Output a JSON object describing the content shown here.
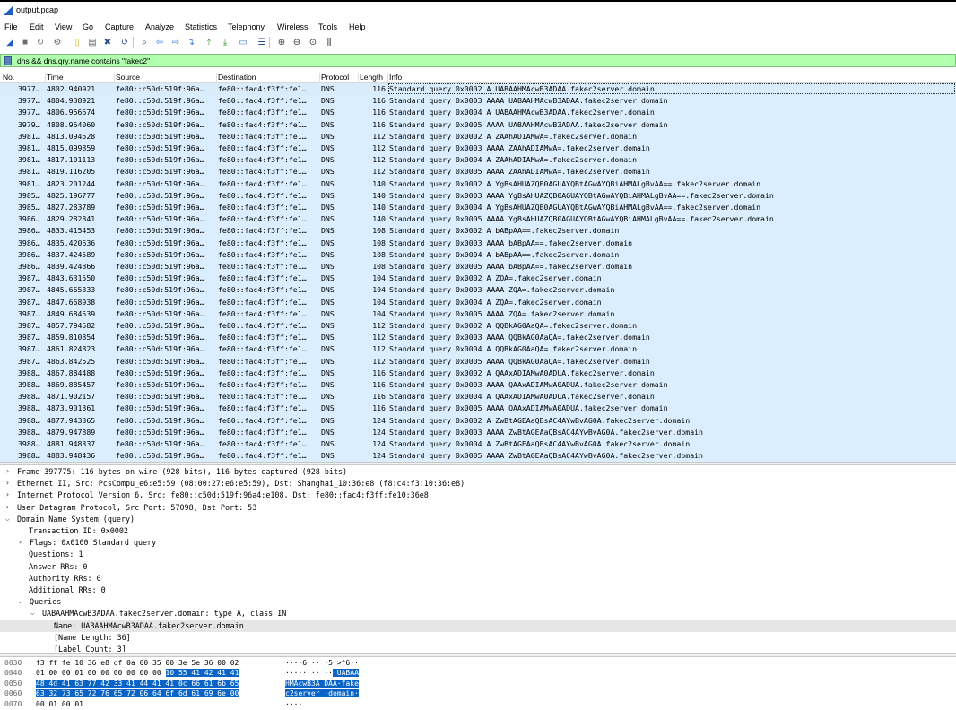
{
  "window": {
    "title": "output.pcap"
  },
  "menu": [
    "File",
    "Edit",
    "View",
    "Go",
    "Capture",
    "Analyze",
    "Statistics",
    "Telephony",
    "Wireless",
    "Tools",
    "Help"
  ],
  "toolbar_icons": [
    "shark-start-icon",
    "stop-icon",
    "restart-icon",
    "options-icon",
    "open-icon",
    "save-icon",
    "close-file-icon",
    "reload-icon",
    "find-icon",
    "back-icon",
    "forward-icon",
    "goto-icon",
    "first-icon",
    "last-icon",
    "autoscroll-icon",
    "colorize-icon",
    "zoom-in-icon",
    "zoom-out-icon",
    "zoom-reset-icon",
    "resize-columns-icon"
  ],
  "filter": {
    "text": "dns && dns.qry.name contains \"fakec2\"",
    "bg": "#afffaf"
  },
  "columns": [
    "No.",
    "Time",
    "Source",
    "Destination",
    "Protocol",
    "Length",
    "Info"
  ],
  "packets": [
    {
      "no": "3977…",
      "time": "4802.940921",
      "src": "fe80::c50d:519f:96a…",
      "dst": "fe80::fac4:f3ff:fe1…",
      "proto": "DNS",
      "len": "116",
      "info": "Standard query 0x0002 A UABAAHMAcwB3ADAA.fakec2server.domain"
    },
    {
      "no": "3977…",
      "time": "4804.938921",
      "src": "fe80::c50d:519f:96a…",
      "dst": "fe80::fac4:f3ff:fe1…",
      "proto": "DNS",
      "len": "116",
      "info": "Standard query 0x0003 AAAA UABAAHMAcwB3ADAA.fakec2server.domain"
    },
    {
      "no": "3977…",
      "time": "4806.956674",
      "src": "fe80::c50d:519f:96a…",
      "dst": "fe80::fac4:f3ff:fe1…",
      "proto": "DNS",
      "len": "116",
      "info": "Standard query 0x0004 A UABAAHMAcwB3ADAA.fakec2server.domain"
    },
    {
      "no": "3979…",
      "time": "4808.964060",
      "src": "fe80::c50d:519f:96a…",
      "dst": "fe80::fac4:f3ff:fe1…",
      "proto": "DNS",
      "len": "116",
      "info": "Standard query 0x0005 AAAA UABAAHMAcwB3ADAA.fakec2server.domain"
    },
    {
      "no": "3981…",
      "time": "4813.094528",
      "src": "fe80::c50d:519f:96a…",
      "dst": "fe80::fac4:f3ff:fe1…",
      "proto": "DNS",
      "len": "112",
      "info": "Standard query 0x0002 A ZAAhADIAMwA=.fakec2server.domain"
    },
    {
      "no": "3981…",
      "time": "4815.099859",
      "src": "fe80::c50d:519f:96a…",
      "dst": "fe80::fac4:f3ff:fe1…",
      "proto": "DNS",
      "len": "112",
      "info": "Standard query 0x0003 AAAA ZAAhADIAMwA=.fakec2server.domain"
    },
    {
      "no": "3981…",
      "time": "4817.101113",
      "src": "fe80::c50d:519f:96a…",
      "dst": "fe80::fac4:f3ff:fe1…",
      "proto": "DNS",
      "len": "112",
      "info": "Standard query 0x0004 A ZAAhADIAMwA=.fakec2server.domain"
    },
    {
      "no": "3981…",
      "time": "4819.116205",
      "src": "fe80::c50d:519f:96a…",
      "dst": "fe80::fac4:f3ff:fe1…",
      "proto": "DNS",
      "len": "112",
      "info": "Standard query 0x0005 AAAA ZAAhADIAMwA=.fakec2server.domain"
    },
    {
      "no": "3981…",
      "time": "4823.201244",
      "src": "fe80::c50d:519f:96a…",
      "dst": "fe80::fac4:f3ff:fe1…",
      "proto": "DNS",
      "len": "140",
      "info": "Standard query 0x0002 A YgBsAHUAZQB0AGUAYQBtAGwAYQBiAHMALgBvAA==.fakec2server.domain"
    },
    {
      "no": "3985…",
      "time": "4825.196777",
      "src": "fe80::c50d:519f:96a…",
      "dst": "fe80::fac4:f3ff:fe1…",
      "proto": "DNS",
      "len": "140",
      "info": "Standard query 0x0003 AAAA YgBsAHUAZQB0AGUAYQBtAGwAYQBiAHMALgBvAA==.fakec2server.domain"
    },
    {
      "no": "3985…",
      "time": "4827.283789",
      "src": "fe80::c50d:519f:96a…",
      "dst": "fe80::fac4:f3ff:fe1…",
      "proto": "DNS",
      "len": "140",
      "info": "Standard query 0x0004 A YgBsAHUAZQB0AGUAYQBtAGwAYQBiAHMALgBvAA==.fakec2server.domain"
    },
    {
      "no": "3986…",
      "time": "4829.282841",
      "src": "fe80::c50d:519f:96a…",
      "dst": "fe80::fac4:f3ff:fe1…",
      "proto": "DNS",
      "len": "140",
      "info": "Standard query 0x0005 AAAA YgBsAHUAZQB0AGUAYQBtAGwAYQBiAHMALgBvAA==.fakec2server.domain"
    },
    {
      "no": "3986…",
      "time": "4833.415453",
      "src": "fe80::c50d:519f:96a…",
      "dst": "fe80::fac4:f3ff:fe1…",
      "proto": "DNS",
      "len": "108",
      "info": "Standard query 0x0002 A bABpAA==.fakec2server.domain"
    },
    {
      "no": "3986…",
      "time": "4835.420636",
      "src": "fe80::c50d:519f:96a…",
      "dst": "fe80::fac4:f3ff:fe1…",
      "proto": "DNS",
      "len": "108",
      "info": "Standard query 0x0003 AAAA bABpAA==.fakec2server.domain"
    },
    {
      "no": "3986…",
      "time": "4837.424589",
      "src": "fe80::c50d:519f:96a…",
      "dst": "fe80::fac4:f3ff:fe1…",
      "proto": "DNS",
      "len": "108",
      "info": "Standard query 0x0004 A bABpAA==.fakec2server.domain"
    },
    {
      "no": "3986…",
      "time": "4839.424866",
      "src": "fe80::c50d:519f:96a…",
      "dst": "fe80::fac4:f3ff:fe1…",
      "proto": "DNS",
      "len": "108",
      "info": "Standard query 0x0005 AAAA bABpAA==.fakec2server.domain"
    },
    {
      "no": "3987…",
      "time": "4843.631550",
      "src": "fe80::c50d:519f:96a…",
      "dst": "fe80::fac4:f3ff:fe1…",
      "proto": "DNS",
      "len": "104",
      "info": "Standard query 0x0002 A ZQA=.fakec2server.domain"
    },
    {
      "no": "3987…",
      "time": "4845.665333",
      "src": "fe80::c50d:519f:96a…",
      "dst": "fe80::fac4:f3ff:fe1…",
      "proto": "DNS",
      "len": "104",
      "info": "Standard query 0x0003 AAAA ZQA=.fakec2server.domain"
    },
    {
      "no": "3987…",
      "time": "4847.668938",
      "src": "fe80::c50d:519f:96a…",
      "dst": "fe80::fac4:f3ff:fe1…",
      "proto": "DNS",
      "len": "104",
      "info": "Standard query 0x0004 A ZQA=.fakec2server.domain"
    },
    {
      "no": "3987…",
      "time": "4849.684539",
      "src": "fe80::c50d:519f:96a…",
      "dst": "fe80::fac4:f3ff:fe1…",
      "proto": "DNS",
      "len": "104",
      "info": "Standard query 0x0005 AAAA ZQA=.fakec2server.domain"
    },
    {
      "no": "3987…",
      "time": "4857.794582",
      "src": "fe80::c50d:519f:96a…",
      "dst": "fe80::fac4:f3ff:fe1…",
      "proto": "DNS",
      "len": "112",
      "info": "Standard query 0x0002 A QQBkAG0AaQA=.fakec2server.domain"
    },
    {
      "no": "3987…",
      "time": "4859.810854",
      "src": "fe80::c50d:519f:96a…",
      "dst": "fe80::fac4:f3ff:fe1…",
      "proto": "DNS",
      "len": "112",
      "info": "Standard query 0x0003 AAAA QQBkAG0AaQA=.fakec2server.domain"
    },
    {
      "no": "3987…",
      "time": "4861.824823",
      "src": "fe80::c50d:519f:96a…",
      "dst": "fe80::fac4:f3ff:fe1…",
      "proto": "DNS",
      "len": "112",
      "info": "Standard query 0x0004 A QQBkAG0AaQA=.fakec2server.domain"
    },
    {
      "no": "3987…",
      "time": "4863.842525",
      "src": "fe80::c50d:519f:96a…",
      "dst": "fe80::fac4:f3ff:fe1…",
      "proto": "DNS",
      "len": "112",
      "info": "Standard query 0x0005 AAAA QQBkAG0AaQA=.fakec2server.domain"
    },
    {
      "no": "3988…",
      "time": "4867.884488",
      "src": "fe80::c50d:519f:96a…",
      "dst": "fe80::fac4:f3ff:fe1…",
      "proto": "DNS",
      "len": "116",
      "info": "Standard query 0x0002 A QAAxADIAMwA0ADUA.fakec2server.domain"
    },
    {
      "no": "3988…",
      "time": "4869.885457",
      "src": "fe80::c50d:519f:96a…",
      "dst": "fe80::fac4:f3ff:fe1…",
      "proto": "DNS",
      "len": "116",
      "info": "Standard query 0x0003 AAAA QAAxADIAMwA0ADUA.fakec2server.domain"
    },
    {
      "no": "3988…",
      "time": "4871.902157",
      "src": "fe80::c50d:519f:96a…",
      "dst": "fe80::fac4:f3ff:fe1…",
      "proto": "DNS",
      "len": "116",
      "info": "Standard query 0x0004 A QAAxADIAMwA0ADUA.fakec2server.domain"
    },
    {
      "no": "3988…",
      "time": "4873.901361",
      "src": "fe80::c50d:519f:96a…",
      "dst": "fe80::fac4:f3ff:fe1…",
      "proto": "DNS",
      "len": "116",
      "info": "Standard query 0x0005 AAAA QAAxADIAMwA0ADUA.fakec2server.domain"
    },
    {
      "no": "3988…",
      "time": "4877.943365",
      "src": "fe80::c50d:519f:96a…",
      "dst": "fe80::fac4:f3ff:fe1…",
      "proto": "DNS",
      "len": "124",
      "info": "Standard query 0x0002 A ZwBtAGEAaQBsAC4AYwBvAG0A.fakec2server.domain"
    },
    {
      "no": "3988…",
      "time": "4879.947889",
      "src": "fe80::c50d:519f:96a…",
      "dst": "fe80::fac4:f3ff:fe1…",
      "proto": "DNS",
      "len": "124",
      "info": "Standard query 0x0003 AAAA ZwBtAGEAaQBsAC4AYwBvAG0A.fakec2server.domain"
    },
    {
      "no": "3988…",
      "time": "4881.948337",
      "src": "fe80::c50d:519f:96a…",
      "dst": "fe80::fac4:f3ff:fe1…",
      "proto": "DNS",
      "len": "124",
      "info": "Standard query 0x0004 A ZwBtAGEAaQBsAC4AYwBvAG0A.fakec2server.domain"
    },
    {
      "no": "3988…",
      "time": "4883.948436",
      "src": "fe80::c50d:519f:96a…",
      "dst": "fe80::fac4:f3ff:fe1…",
      "proto": "DNS",
      "len": "124",
      "info": "Standard query 0x0005 AAAA ZwBtAGEAaQBsAC4AYwBvAG0A.fakec2server.domain"
    }
  ],
  "details": [
    {
      "arrow": ">",
      "indent": 0,
      "text": "Frame 397775: 116 bytes on wire (928 bits), 116 bytes captured (928 bits)"
    },
    {
      "arrow": ">",
      "indent": 0,
      "text": "Ethernet II, Src: PcsCompu_e6:e5:59 (08:00:27:e6:e5:59), Dst: Shanghai_10:36:e8 (f8:c4:f3:10:36:e8)"
    },
    {
      "arrow": ">",
      "indent": 0,
      "text": "Internet Protocol Version 6, Src: fe80::c50d:519f:96a4:e108, Dst: fe80::fac4:f3ff:fe10:36e8"
    },
    {
      "arrow": ">",
      "indent": 0,
      "text": "User Datagram Protocol, Src Port: 57098, Dst Port: 53"
    },
    {
      "arrow": "v",
      "indent": 0,
      "text": "Domain Name System (query)"
    },
    {
      "arrow": "",
      "indent": 1,
      "text": "Transaction ID: 0x0002"
    },
    {
      "arrow": ">",
      "indent": 1,
      "text": "Flags: 0x0100 Standard query"
    },
    {
      "arrow": "",
      "indent": 1,
      "text": "Questions: 1"
    },
    {
      "arrow": "",
      "indent": 1,
      "text": "Answer RRs: 0"
    },
    {
      "arrow": "",
      "indent": 1,
      "text": "Authority RRs: 0"
    },
    {
      "arrow": "",
      "indent": 1,
      "text": "Additional RRs: 0"
    },
    {
      "arrow": "v",
      "indent": 1,
      "text": "Queries"
    },
    {
      "arrow": "v",
      "indent": 2,
      "text": "UABAAHMAcwB3ADAA.fakec2server.domain: type A, class IN"
    },
    {
      "arrow": "",
      "indent": 3,
      "text": "Name: UABAAHMAcwB3ADAA.fakec2server.domain",
      "hl": true
    },
    {
      "arrow": "",
      "indent": 3,
      "text": "[Name Length: 36]"
    },
    {
      "arrow": "",
      "indent": 3,
      "text": "[Label Count: 3]"
    }
  ],
  "hex": [
    {
      "off": "0030",
      "pre": "f3 ff fe 10 36 e8 df 0a  00 35 00 3e 5e 36 00 02",
      "sel": "",
      "post": "",
      "apre": "····6···  ·5·>^6··",
      "asel": "",
      "apost": ""
    },
    {
      "off": "0040",
      "pre": "01 00 00 01 00 00 00 00  00 00 ",
      "sel": "10 55 41 42 41 41",
      "post": "",
      "apre": "········ ··",
      "asel": "·UABAA",
      "apost": ""
    },
    {
      "off": "0050",
      "pre": "",
      "sel": "48 4d 41 63 77 42 33 41  44 41 41 0c 66 61 6b 65",
      "post": "",
      "apre": "",
      "asel": "HMAcwB3A DAA·fake",
      "apost": ""
    },
    {
      "off": "0060",
      "pre": "",
      "sel": "63 32 73 65 72 76 65 72  06 64 6f 6d 61 69 6e 00",
      "post": "",
      "apre": "",
      "asel": "c2server ·domain·",
      "apost": ""
    },
    {
      "off": "0070",
      "pre": "00 01 00 01",
      "sel": "",
      "post": "",
      "apre": "····",
      "asel": "",
      "apost": ""
    }
  ],
  "colors": {
    "row_bg": "#daeeff",
    "hex_sel": "#0a64c8"
  }
}
